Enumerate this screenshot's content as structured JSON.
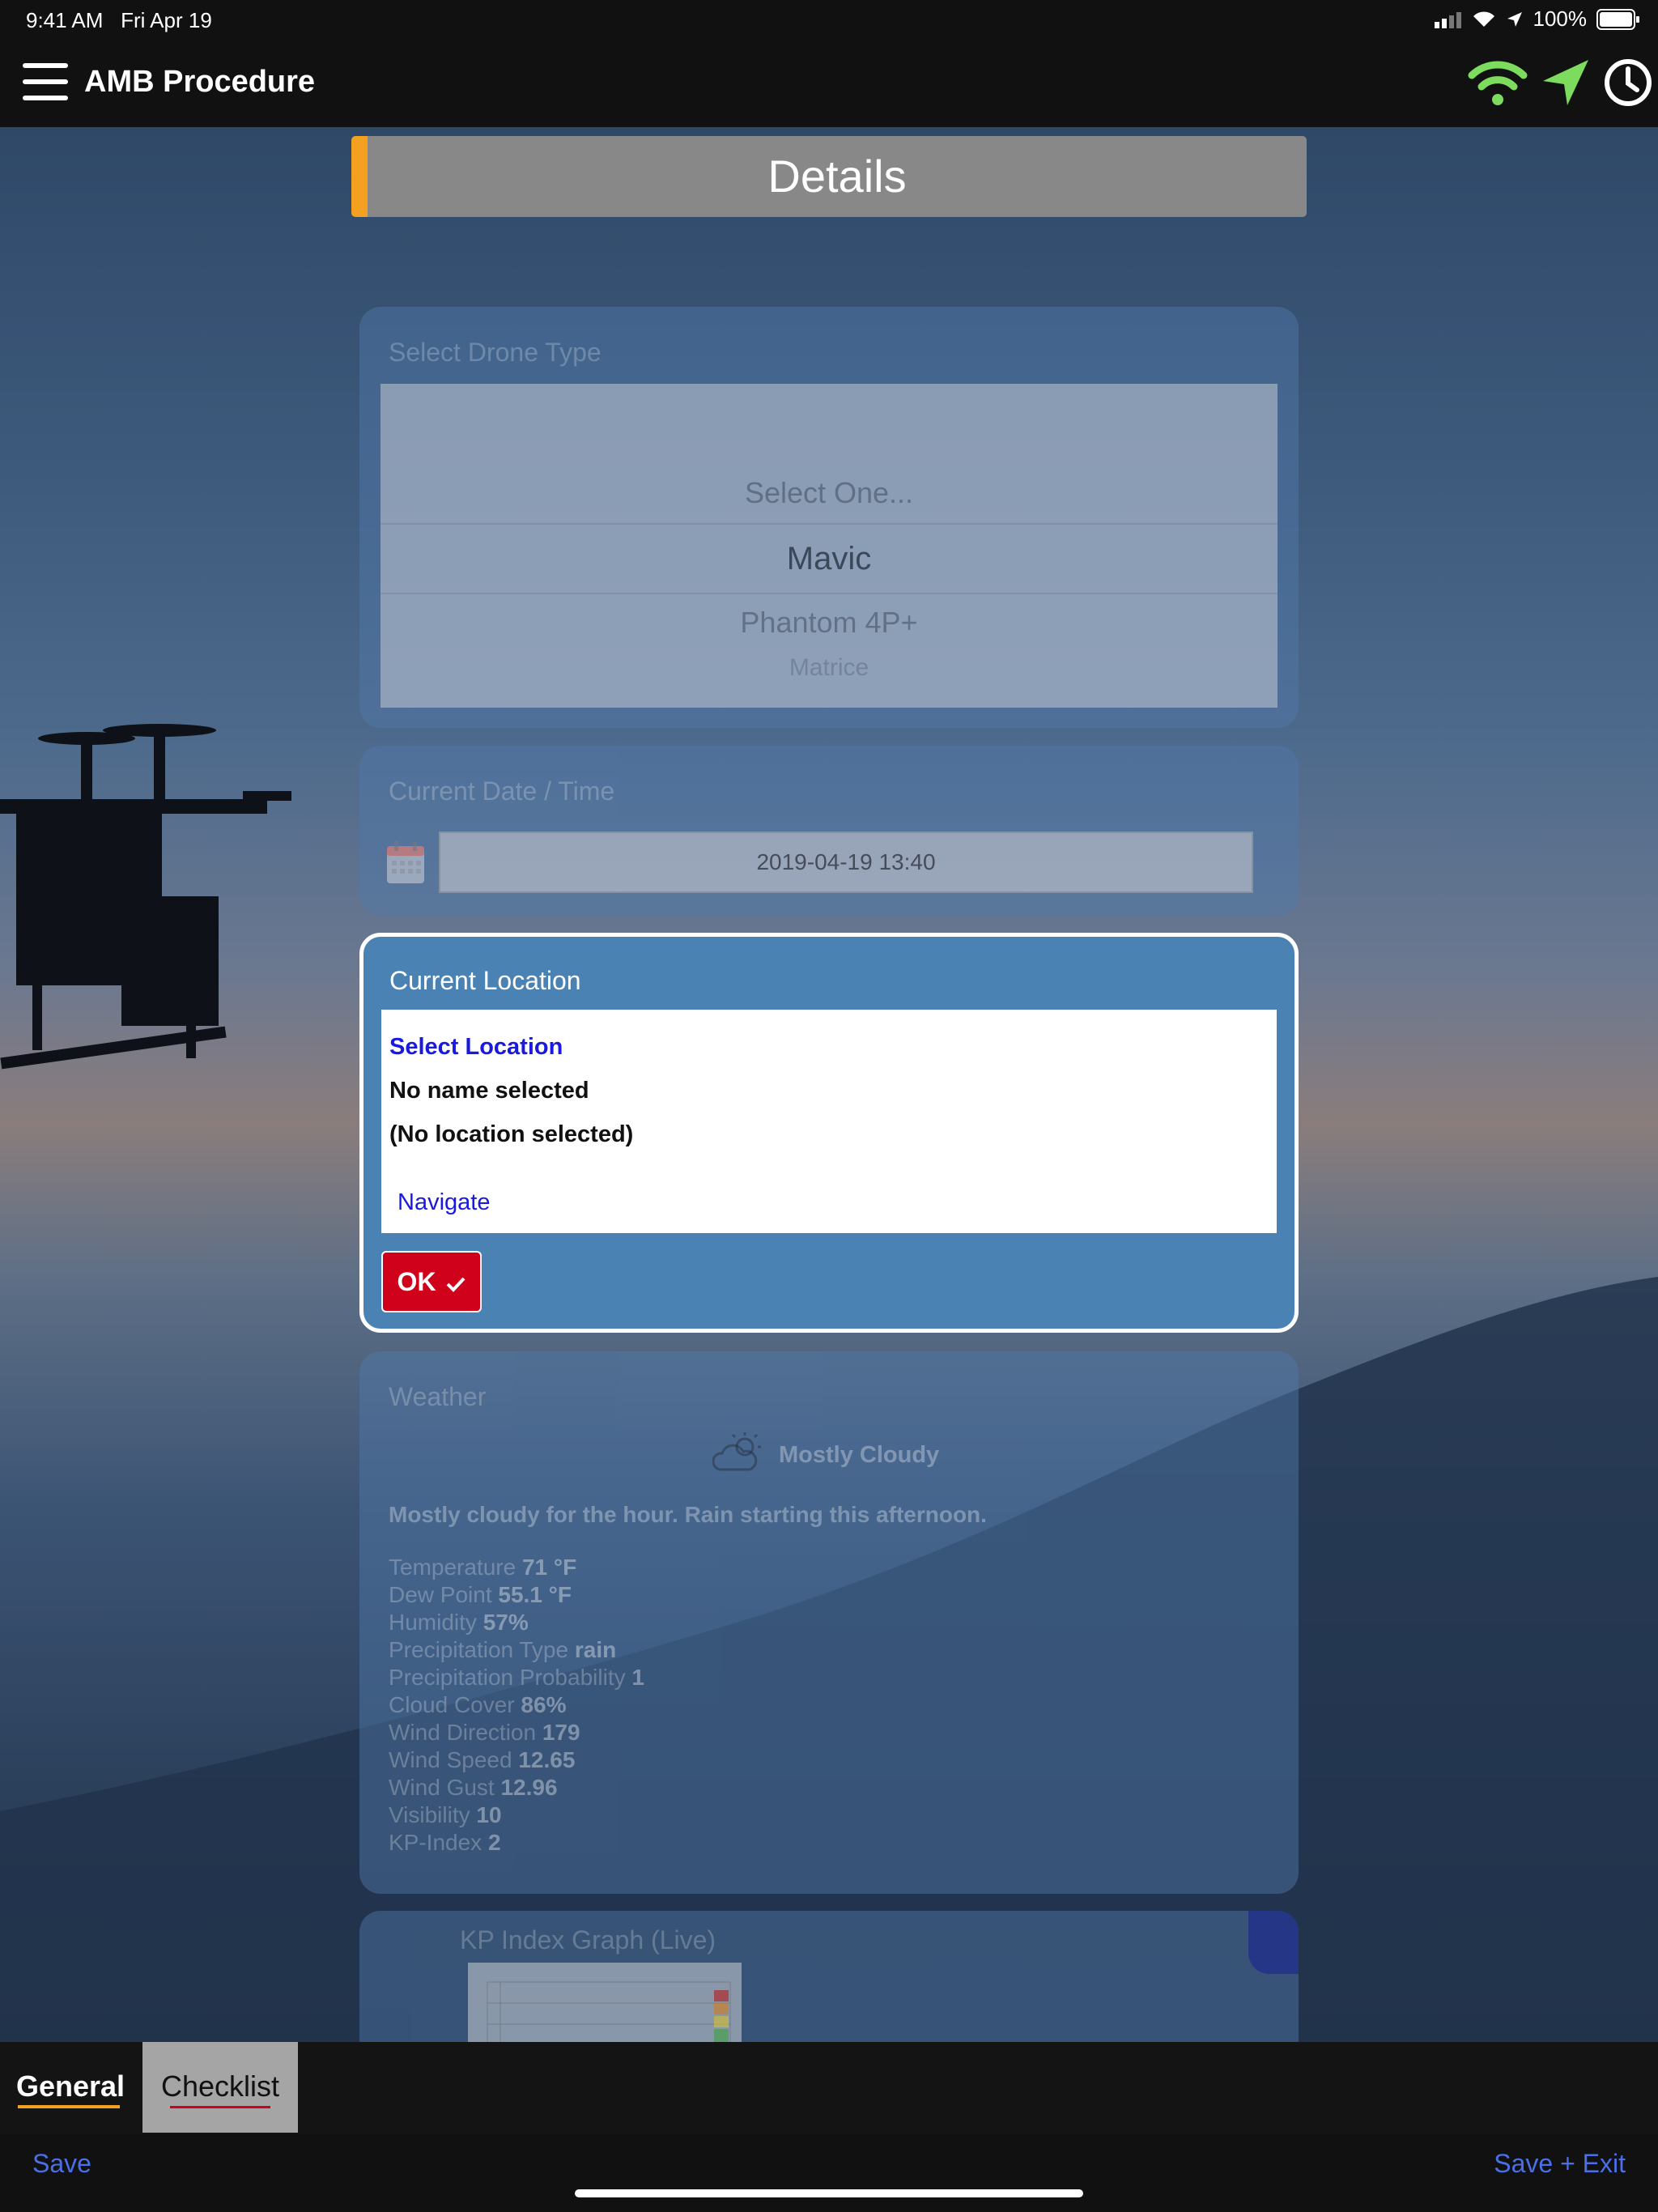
{
  "status_bar": {
    "time": "9:41 AM",
    "date": "Fri Apr 19",
    "battery": "100%"
  },
  "app_bar": {
    "title": "AMB Procedure"
  },
  "details": {
    "title": "Details"
  },
  "drone_type": {
    "label": "Select Drone Type",
    "options": [
      "Select One...",
      "Mavic",
      "Phantom 4P+",
      "Matrice"
    ],
    "selected": "Mavic"
  },
  "datetime": {
    "label": "Current Date / Time",
    "value": "2019-04-19 13:40"
  },
  "location": {
    "title": "Current Location",
    "select_link": "Select Location",
    "name": "No name selected",
    "location": "(No location selected)",
    "navigate": "Navigate",
    "ok": "OK"
  },
  "weather": {
    "label": "Weather",
    "condition": "Mostly Cloudy",
    "summary": "Mostly cloudy for the hour. Rain starting this afternoon.",
    "rows": [
      {
        "k": "Temperature",
        "v": "71 °F"
      },
      {
        "k": "Dew Point",
        "v": "55.1 °F"
      },
      {
        "k": "Humidity",
        "v": "57%"
      },
      {
        "k": "Precipitation Type",
        "v": "rain"
      },
      {
        "k": "Precipitation Probability",
        "v": "1"
      },
      {
        "k": "Cloud Cover",
        "v": "86%"
      },
      {
        "k": "Wind Direction",
        "v": "179"
      },
      {
        "k": "Wind Speed",
        "v": "12.65"
      },
      {
        "k": "Wind Gust",
        "v": "12.96"
      },
      {
        "k": "Visibility",
        "v": "10"
      },
      {
        "k": "KP-Index",
        "v": "2"
      }
    ]
  },
  "kp_graph": {
    "label": "KP Index Graph (Live)"
  },
  "tabs": {
    "general": "General",
    "checklist": "Checklist"
  },
  "bottom": {
    "save": "Save",
    "save_exit": "Save + Exit"
  },
  "colors": {
    "accent": "#f4a020",
    "ok_red": "#d0021b",
    "link_blue": "#1a1adf",
    "status_green": "#7ddc5e"
  }
}
